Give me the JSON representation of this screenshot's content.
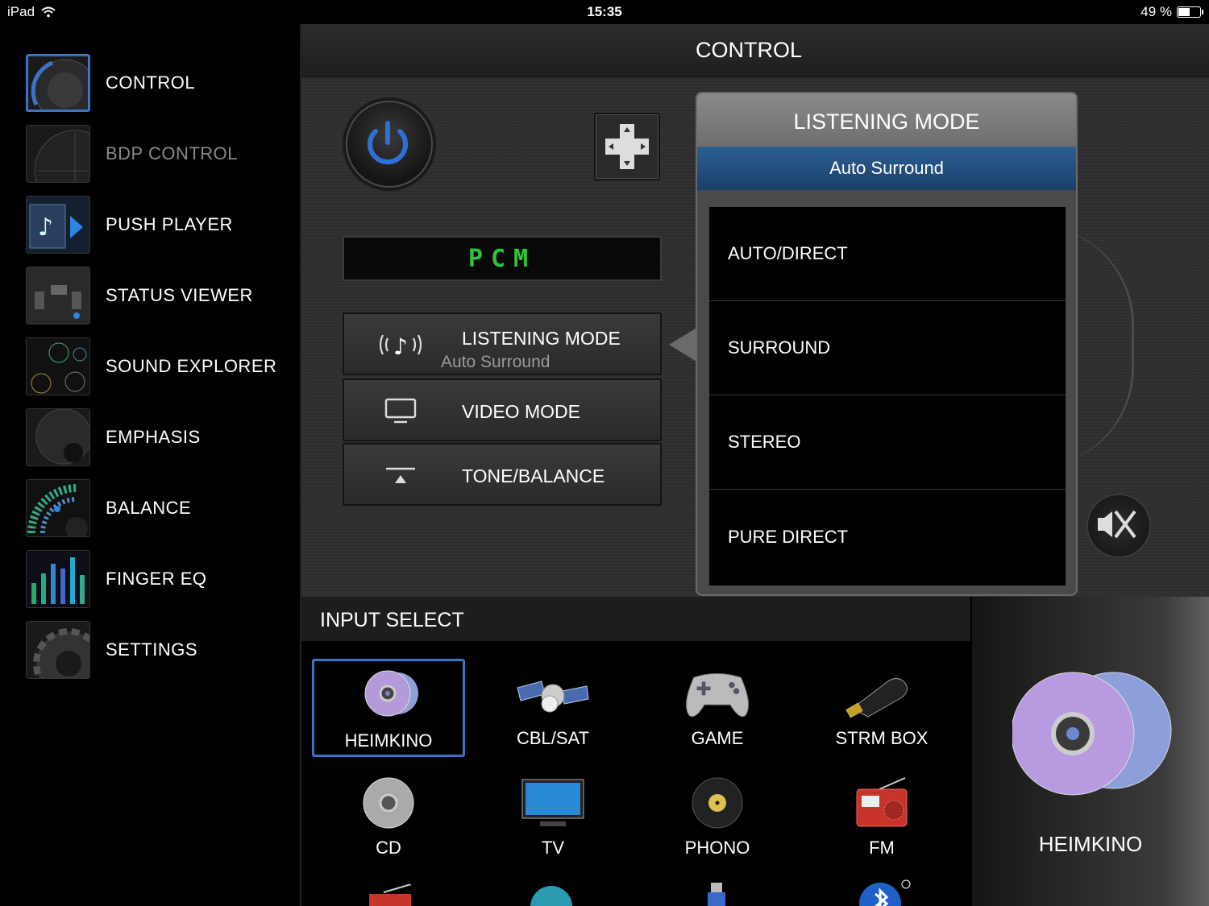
{
  "status_bar": {
    "device": "iPad",
    "time": "15:35",
    "battery": "49 %",
    "battery_level": 0.49
  },
  "sidebar": {
    "items": [
      {
        "label": "CONTROL",
        "icon": "control-dial-icon",
        "active": true
      },
      {
        "label": "BDP CONTROL",
        "icon": "bdp-control-icon",
        "dim": true
      },
      {
        "label": "PUSH PLAYER",
        "icon": "push-player-icon"
      },
      {
        "label": "STATUS VIEWER",
        "icon": "status-viewer-icon"
      },
      {
        "label": "SOUND EXPLORER",
        "icon": "sound-explorer-icon"
      },
      {
        "label": "EMPHASIS",
        "icon": "emphasis-speaker-icon"
      },
      {
        "label": "BALANCE",
        "icon": "balance-icon"
      },
      {
        "label": "FINGER EQ",
        "icon": "finger-eq-icon"
      },
      {
        "label": "SETTINGS",
        "icon": "settings-gear-icon"
      }
    ]
  },
  "header": {
    "title": "CONTROL"
  },
  "control": {
    "display": "PCM",
    "listening_mode_label": "LISTENING MODE",
    "listening_mode_value": "Auto Surround",
    "video_mode_label": "VIDEO MODE",
    "tone_balance_label": "TONE/BALANCE"
  },
  "popup": {
    "title": "LISTENING MODE",
    "current": "Auto Surround",
    "options": [
      "AUTO/DIRECT",
      "SURROUND",
      "STEREO",
      "PURE DIRECT"
    ]
  },
  "input_select": {
    "title": "INPUT SELECT",
    "inputs": [
      {
        "label": "HEIMKINO",
        "icon": "disc-icon",
        "selected": true
      },
      {
        "label": "CBL/SAT",
        "icon": "satellite-icon"
      },
      {
        "label": "GAME",
        "icon": "gamepad-icon"
      },
      {
        "label": "STRM BOX",
        "icon": "stream-stick-icon"
      },
      {
        "label": "CD",
        "icon": "cd-icon"
      },
      {
        "label": "TV",
        "icon": "tv-icon"
      },
      {
        "label": "PHONO",
        "icon": "vinyl-record-icon"
      },
      {
        "label": "FM",
        "icon": "radio-icon"
      }
    ]
  },
  "current_input": {
    "label": "HEIMKINO"
  },
  "colors": {
    "accent": "#3a74c8",
    "display_green": "#2fc43a",
    "popup_current": "#2c5f93"
  }
}
